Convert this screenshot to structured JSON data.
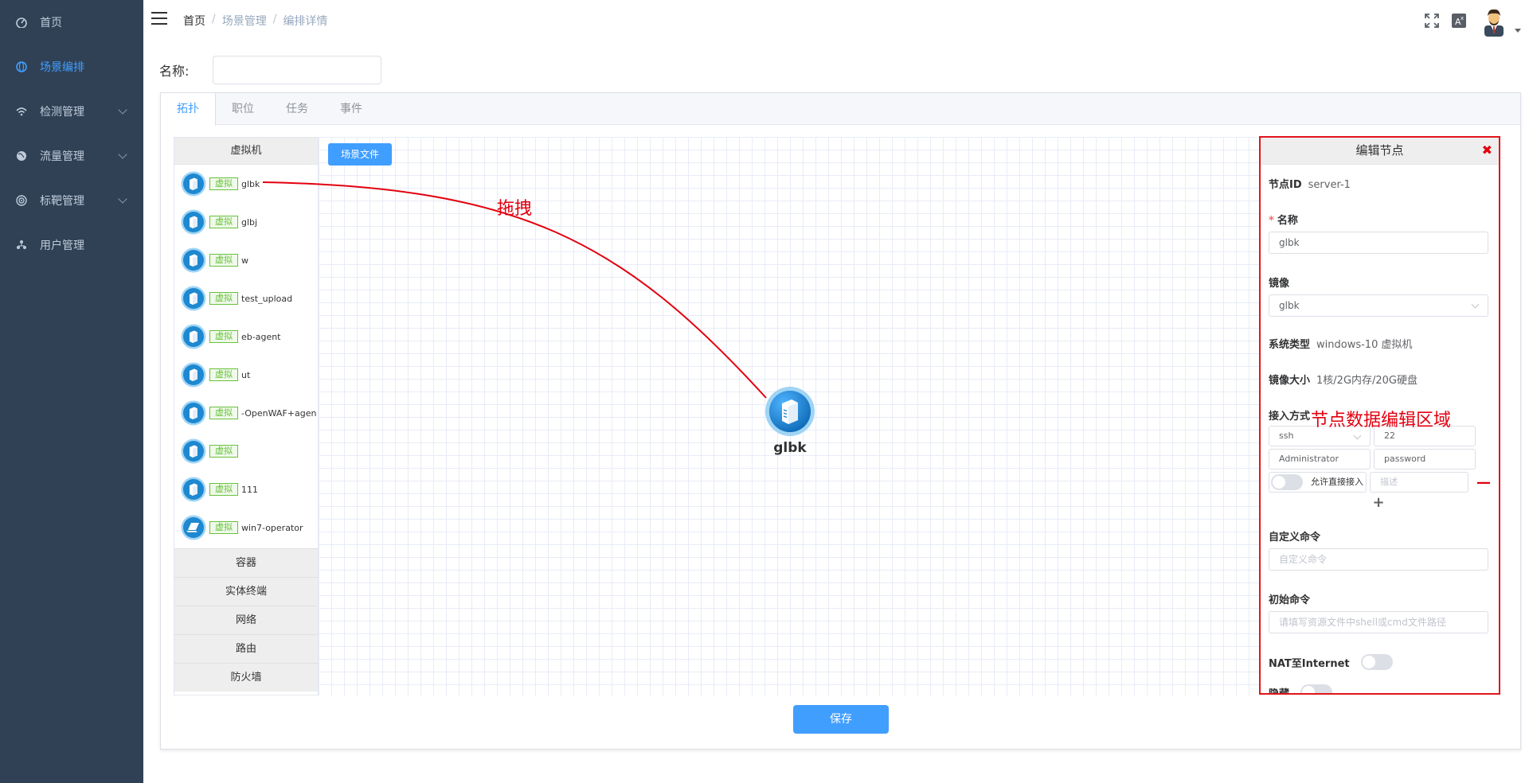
{
  "sidebar": {
    "items": [
      {
        "label": "首页",
        "icon": "dashboard-icon",
        "active": false,
        "expandable": false
      },
      {
        "label": "场景编排",
        "icon": "globe-icon",
        "active": true,
        "expandable": false
      },
      {
        "label": "检测管理",
        "icon": "wifi-icon",
        "active": false,
        "expandable": true
      },
      {
        "label": "流量管理",
        "icon": "earth-icon",
        "active": false,
        "expandable": true
      },
      {
        "label": "标靶管理",
        "icon": "target-icon",
        "active": false,
        "expandable": true
      },
      {
        "label": "用户管理",
        "icon": "users-icon",
        "active": false,
        "expandable": false
      }
    ]
  },
  "header": {
    "breadcrumb": [
      "首页",
      "场景管理",
      "编排详情"
    ],
    "separator": "/",
    "icons": [
      "fullscreen-icon",
      "translate-icon"
    ]
  },
  "form": {
    "name_label": "名称:",
    "name_value": ""
  },
  "tabs": [
    "拓扑",
    "职位",
    "任务",
    "事件"
  ],
  "palette": {
    "header": "虚拟机",
    "tag": "虚拟",
    "items": [
      {
        "name": "glbk",
        "icon": "server-icon"
      },
      {
        "name": "glbj",
        "icon": "server-icon"
      },
      {
        "name": "w",
        "icon": "server-icon"
      },
      {
        "name": "test_upload",
        "icon": "server-icon"
      },
      {
        "name": "eb-agent",
        "icon": "server-icon"
      },
      {
        "name": "ut",
        "icon": "server-icon"
      },
      {
        "name": "-OpenWAF+agen",
        "icon": "server-icon"
      },
      {
        "name": "",
        "icon": "server-icon"
      },
      {
        "name": "111",
        "icon": "server-icon"
      },
      {
        "name": "win7-operator",
        "icon": "laptop-icon"
      }
    ],
    "categories": [
      "容器",
      "实体终端",
      "网络",
      "路由",
      "防火墙"
    ]
  },
  "canvas": {
    "scene_button": "场景文件",
    "node_label": "glbk"
  },
  "annotations": {
    "drag": "拖拽",
    "edit_area": "节点数据编辑区域",
    "color": "#e3000f"
  },
  "edit_panel": {
    "title": "编辑节点",
    "node_id_label": "节点ID",
    "node_id_value": "server-1",
    "name_label": "名称",
    "name_value": "glbk",
    "image_label": "镜像",
    "image_value": "glbk",
    "os_label": "系统类型",
    "os_value": "windows-10 虚拟机",
    "size_label": "镜像大小",
    "size_value": "1核/2G内存/20G硬盘",
    "access_label": "接入方式",
    "access": {
      "protocol": "ssh",
      "port": "22",
      "username": "Administrator",
      "password": "password",
      "allow_direct_label": "允许直接接入",
      "desc_placeholder": "描述"
    },
    "custom_cmd_label": "自定义命令",
    "custom_cmd_placeholder": "自定义命令",
    "init_cmd_label": "初始命令",
    "init_cmd_placeholder": "请填写资源文件中shell或cmd文件路径",
    "nat_label": "NAT至Internet",
    "hidden_label": "隐藏"
  },
  "save_button": "保存",
  "colors": {
    "sidebar_bg": "#304156",
    "sidebar_text": "#bfcbd9",
    "accent": "#409eff",
    "tag_green": "#67c23a",
    "highlight_red": "#e3141b"
  }
}
